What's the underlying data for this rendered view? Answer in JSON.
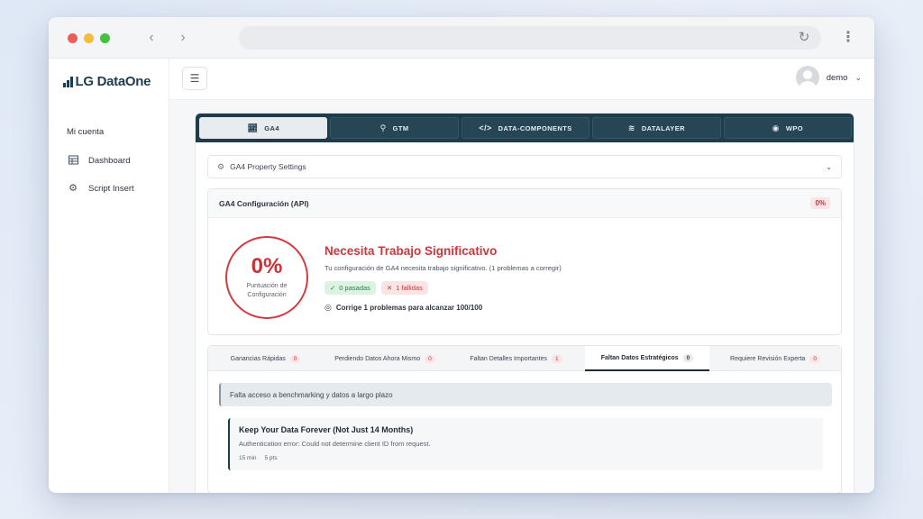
{
  "brand": {
    "name": "LG DataOne"
  },
  "sidebar": {
    "section": "Mi cuenta",
    "items": [
      {
        "label": "Dashboard",
        "icon": "table-icon"
      },
      {
        "label": "Script Insert",
        "icon": "gear-icon"
      }
    ]
  },
  "topbar": {
    "username": "demo"
  },
  "tabs": [
    {
      "label": "GA4",
      "icon": "chart-line-icon",
      "active": true
    },
    {
      "label": "GTM",
      "icon": "search-icon",
      "active": false
    },
    {
      "label": "DATA-COMPONENTS",
      "icon": "code-icon",
      "active": false
    },
    {
      "label": "DATALAYER",
      "icon": "layers-icon",
      "active": false
    },
    {
      "label": "WPO",
      "icon": "speedometer-icon",
      "active": false
    }
  ],
  "property_settings": {
    "label": "GA4 Property Settings"
  },
  "config": {
    "title": "GA4 Configuración (API)",
    "badge": "0%",
    "score": "0%",
    "score_label_1": "Puntuación de",
    "score_label_2": "Configuración",
    "status_title": "Necesita Trabajo Significativo",
    "status_desc": "Tu configuración de GA4 necesita trabajo significativo. (1 problemas a corregir)",
    "passed": "0 pasadas",
    "failed": "1 fallidas",
    "fix_text": "Corrige 1 problemas para alcanzar 100/100"
  },
  "subtabs": [
    {
      "label": "Ganancias Rápidas",
      "count": "0",
      "active": false
    },
    {
      "label": "Perdiendo Datos Ahora Mismo",
      "count": "0",
      "active": false
    },
    {
      "label": "Faltan Detalles Importantes",
      "count": "1",
      "active": false
    },
    {
      "label": "Faltan Datos Estratégicos",
      "count": "0",
      "active": true
    },
    {
      "label": "Requiere Revisión Experta",
      "count": "0",
      "active": false
    }
  ],
  "alert": "Falta acceso a benchmarking y datos a largo plazo",
  "issue": {
    "title": "Keep Your Data Forever (Not Just 14 Months)",
    "desc": "Authentication error: Could not determine client ID from request.",
    "time": "15 min",
    "points": "5 pts"
  },
  "colors": {
    "brand": "#1f3c4c",
    "danger": "#d0343c",
    "success": "#22804a"
  }
}
